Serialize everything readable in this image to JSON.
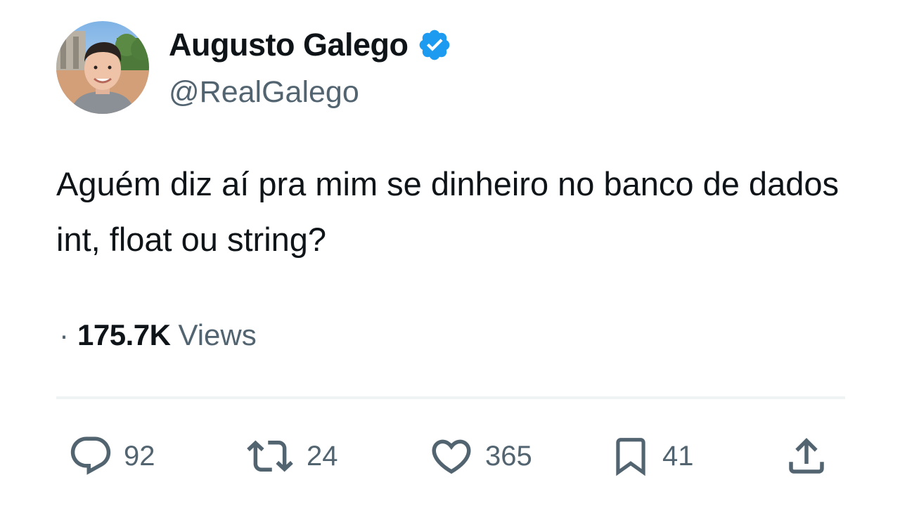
{
  "author": {
    "display_name": "Augusto Galego",
    "handle": "@RealGalego",
    "verified": true,
    "verified_badge_color": "#1d9bf0"
  },
  "tweet": {
    "text": "Aguém diz aí pra mim se dinheiro no banco de dados int, float ou string?"
  },
  "meta": {
    "separator": "·",
    "views_count": "175.7K",
    "views_label": "Views"
  },
  "actions": {
    "reply": {
      "icon": "reply-icon",
      "count": "92"
    },
    "retweet": {
      "icon": "retweet-icon",
      "count": "24"
    },
    "like": {
      "icon": "heart-icon",
      "count": "365"
    },
    "bookmark": {
      "icon": "bookmark-icon",
      "count": "41"
    },
    "share": {
      "icon": "share-icon"
    }
  },
  "colors": {
    "text_primary": "#0f1419",
    "text_secondary": "#536471",
    "divider": "#eff3f4"
  }
}
